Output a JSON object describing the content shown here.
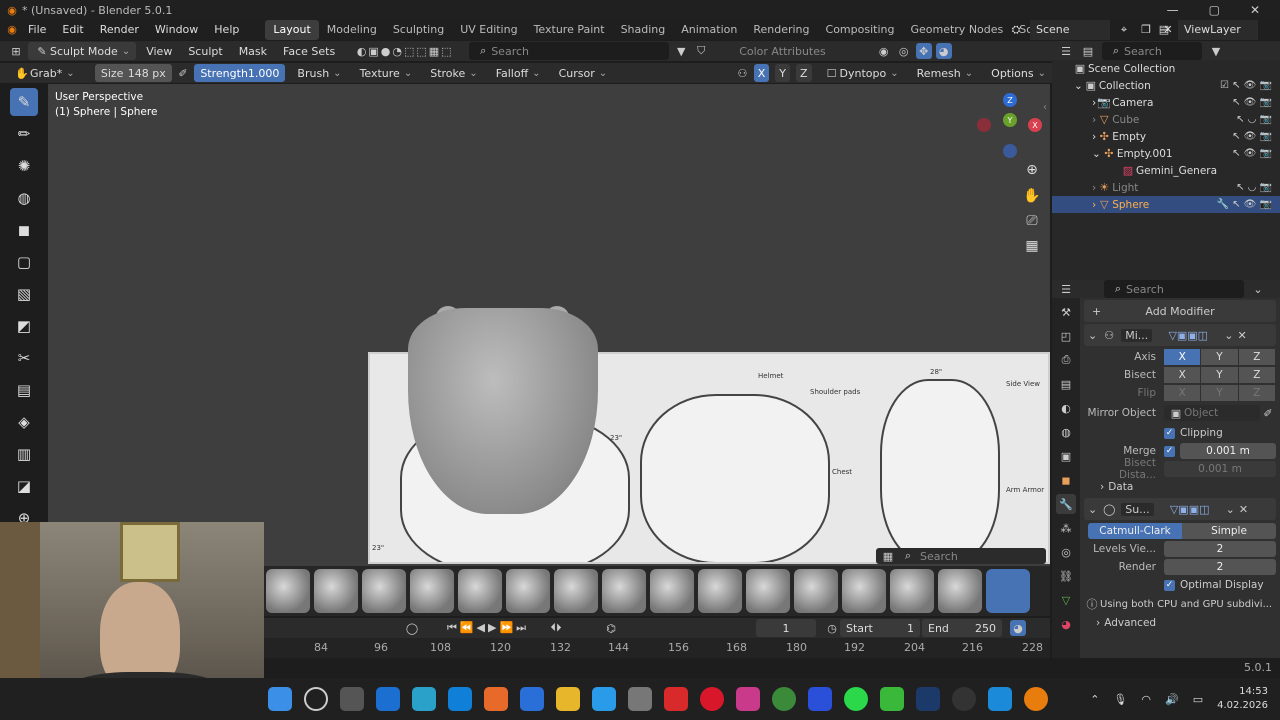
{
  "window": {
    "title": "* (Unsaved) - Blender 5.0.1"
  },
  "menu": [
    "File",
    "Edit",
    "Render",
    "Window",
    "Help"
  ],
  "workspaces": [
    "Layout",
    "Modeling",
    "Sculpting",
    "UV Editing",
    "Texture Paint",
    "Shading",
    "Animation",
    "Rendering",
    "Compositing",
    "Geometry Nodes",
    "Scripting"
  ],
  "scene": {
    "name": "Scene",
    "view_layer": "ViewLayer"
  },
  "header": {
    "mode": "Sculpt Mode",
    "menus": [
      "View",
      "Sculpt",
      "Mask",
      "Face Sets"
    ],
    "search_placeholder": "Search",
    "color_attributes": "Color Attributes"
  },
  "tool_settings": {
    "brush": "Grab*",
    "size_label": "Size",
    "size_value": "148 px",
    "strength_label": "Strength",
    "strength_value": "1.000",
    "menus": [
      "Brush",
      "Texture",
      "Stroke",
      "Falloff",
      "Cursor"
    ],
    "axes": [
      "X",
      "Y",
      "Z"
    ],
    "dyntopo": "Dyntopo",
    "remesh": "Remesh",
    "options": "Options"
  },
  "viewport": {
    "view_name": "User Perspective",
    "object_info": "(1) Sphere | Sphere",
    "search_placeholder": "Search"
  },
  "reference": {
    "labels": [
      "Helmet",
      "Shoulder pads",
      "Side View",
      "Chest",
      "Arm Armor",
      "23\"",
      "28\"",
      "23\""
    ]
  },
  "outliner": {
    "search_placeholder": "Search",
    "scene_collection": "Scene Collection",
    "items": [
      {
        "name": "Collection",
        "level": 0
      },
      {
        "name": "Camera",
        "level": 1
      },
      {
        "name": "Cube",
        "level": 1
      },
      {
        "name": "Empty",
        "level": 1
      },
      {
        "name": "Empty.001",
        "level": 1
      },
      {
        "name": "Gemini_Genera",
        "level": 2
      },
      {
        "name": "Light",
        "level": 1
      },
      {
        "name": "Sphere",
        "level": 1,
        "selected": true
      }
    ]
  },
  "properties": {
    "search_placeholder": "Search",
    "add_modifier": "Add Modifier",
    "mirror": {
      "name": "Mi...",
      "axis_label": "Axis",
      "bisect_label": "Bisect",
      "flip_label": "Flip",
      "axes": [
        "X",
        "Y",
        "Z"
      ],
      "mirror_object_label": "Mirror Object",
      "mirror_object_placeholder": "Object",
      "clipping": "Clipping",
      "merge_label": "Merge",
      "merge_value": "0.001 m",
      "bisect_distance_label": "Bisect Dista...",
      "bisect_distance_value": "0.001 m",
      "data": "Data"
    },
    "subsurf": {
      "name": "Su...",
      "catmull": "Catmull-Clark",
      "simple": "Simple",
      "levels_label": "Levels Vie...",
      "levels_value": "2",
      "render_label": "Render",
      "render_value": "2",
      "optimal": "Optimal Display",
      "note": "Using both CPU and GPU subdivi...",
      "advanced": "Advanced"
    }
  },
  "timeline": {
    "current_frame": "1",
    "start_label": "Start",
    "start": "1",
    "end_label": "End",
    "end": "250",
    "ticks": [
      "84",
      "96",
      "108",
      "120",
      "132",
      "144",
      "156",
      "168",
      "180",
      "192",
      "204",
      "216",
      "228"
    ]
  },
  "status": {
    "version": "5.0.1"
  },
  "taskbar": {
    "time": "14:53",
    "date": "4.02.2026"
  },
  "colors": {
    "accent": "#4772b3",
    "panel": "#303030",
    "viewport": "#3e3e3e"
  }
}
